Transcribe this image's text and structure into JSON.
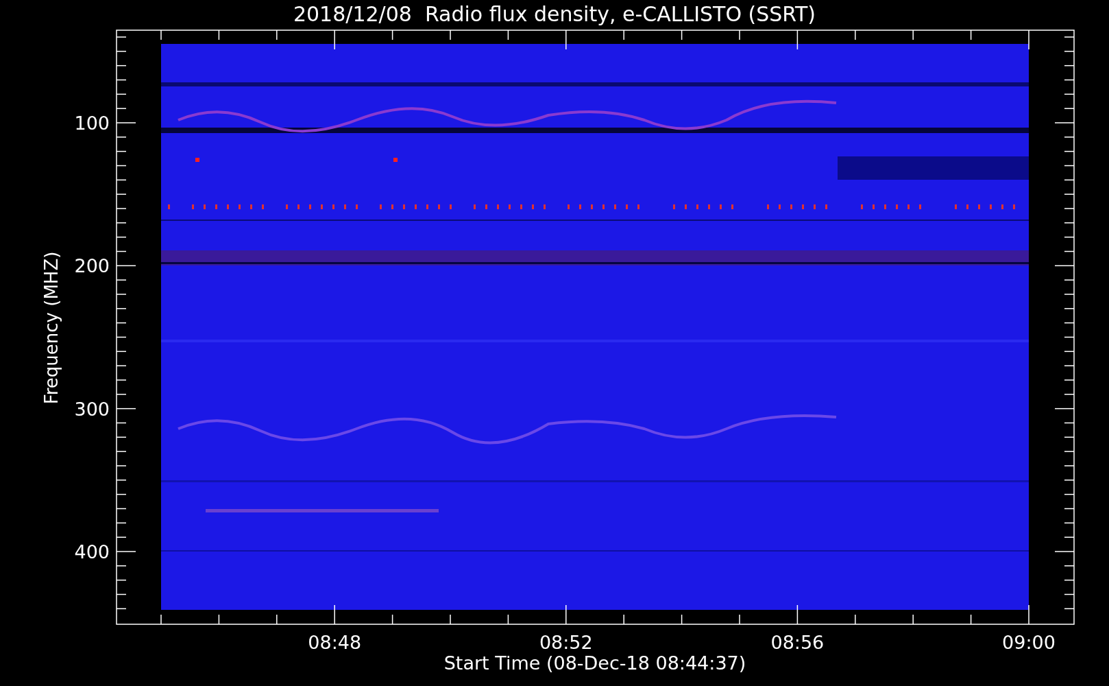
{
  "title": "2018/12/08  Radio flux density, e-CALLISTO (SSRT)",
  "y_axis": {
    "label": "Frequency (MHZ)",
    "tick_labels": [
      "100",
      "200",
      "300",
      "400"
    ]
  },
  "x_axis": {
    "label": "Start Time (08-Dec-18 08:44:37)",
    "tick_labels": [
      "08:48",
      "08:52",
      "08:56",
      "09:00"
    ]
  }
}
